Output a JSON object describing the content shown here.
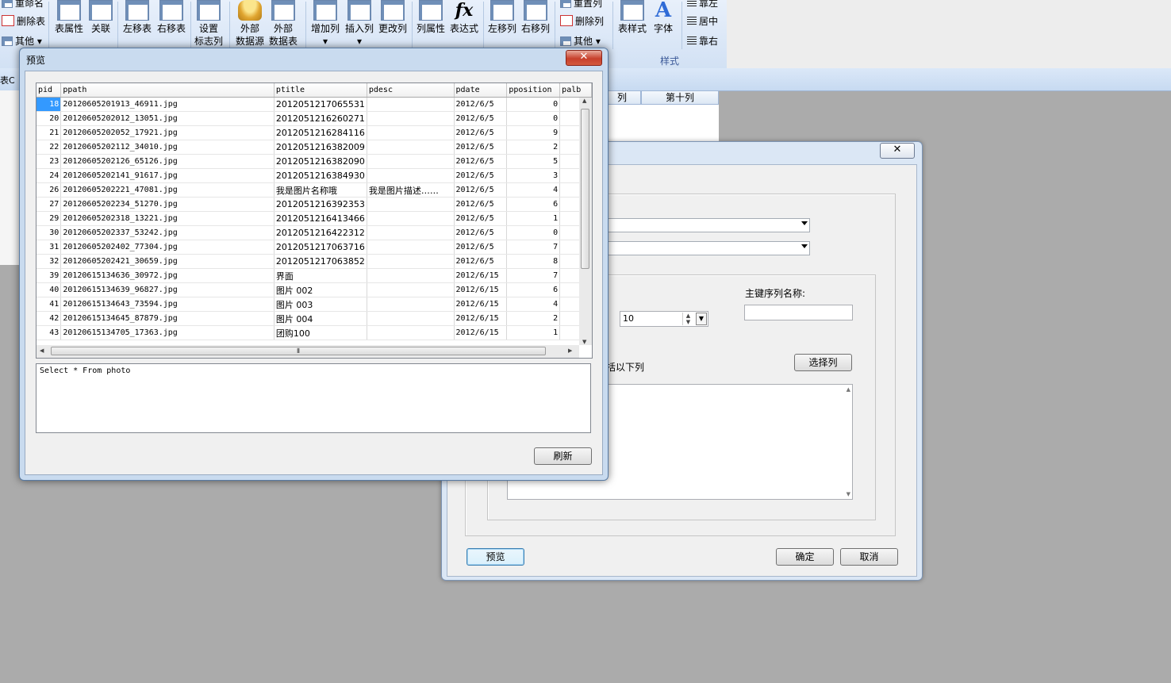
{
  "ribbon": {
    "small_left": [
      {
        "label": "重命名",
        "icon": "rename-icon"
      },
      {
        "label": "删除表",
        "icon": "delete-table-icon"
      },
      {
        "label": "其他",
        "icon": "other-icon"
      }
    ],
    "buttons": [
      {
        "label": "表属性",
        "icon": "table-properties-icon"
      },
      {
        "label": "关联",
        "icon": "relation-icon"
      },
      {
        "label": "左移表",
        "icon": "move-table-left-icon"
      },
      {
        "label": "右移表",
        "icon": "move-table-right-icon"
      },
      {
        "label": "设置\n标志列",
        "icon": "flag-column-icon"
      },
      {
        "label": "外部\n数据源",
        "icon": "external-datasource-icon"
      },
      {
        "label": "外部\n数据表",
        "icon": "external-table-icon"
      },
      {
        "label": "增加列",
        "icon": "add-column-icon"
      },
      {
        "label": "插入列",
        "icon": "insert-column-icon"
      },
      {
        "label": "更改列",
        "icon": "edit-column-icon"
      },
      {
        "label": "列属性",
        "icon": "column-properties-icon"
      },
      {
        "label": "表达式",
        "icon": "fx-icon"
      },
      {
        "label": "左移列",
        "icon": "move-column-left-icon"
      },
      {
        "label": "右移列",
        "icon": "move-column-right-icon"
      },
      {
        "label": "表样式",
        "icon": "table-style-icon"
      },
      {
        "label": "字体",
        "icon": "font-icon"
      }
    ],
    "small_mid": [
      {
        "label": "重置列",
        "icon": "reset-column-icon"
      },
      {
        "label": "删除列",
        "icon": "delete-column-icon"
      },
      {
        "label": "其他",
        "icon": "other-icon"
      }
    ],
    "small_align": [
      {
        "label": "靠左",
        "icon": "align-left-icon"
      },
      {
        "label": "居中",
        "icon": "align-center-icon"
      },
      {
        "label": "靠右",
        "icon": "align-right-icon"
      }
    ],
    "group_style": "样式"
  },
  "background": {
    "subbar_tab": "表C",
    "grid_headers": [
      "列",
      "第十列"
    ]
  },
  "bg_dialog": {
    "close_glyph": "✕",
    "pk_seq_label": "主键序列名称:",
    "spinner_value": "10",
    "include_cols_label": "括以下列",
    "select_cols_button": "选择列",
    "preview_button": "预览",
    "ok_button": "确定",
    "cancel_button": "取消"
  },
  "preview": {
    "title": "预览",
    "close_glyph": "✕",
    "columns": [
      "pid",
      "ppath",
      "ptitle",
      "pdesc",
      "pdate",
      "pposition",
      "palb"
    ],
    "rows": [
      [
        "18",
        "20120605201913_46911.jpg",
        "2012051217065531",
        "",
        "2012/6/5",
        "0"
      ],
      [
        "20",
        "20120605202012_13051.jpg",
        "2012051216260271",
        "",
        "2012/6/5",
        "0"
      ],
      [
        "21",
        "20120605202052_17921.jpg",
        "2012051216284116",
        "",
        "2012/6/5",
        "9"
      ],
      [
        "22",
        "20120605202112_34010.jpg",
        "2012051216382009",
        "",
        "2012/6/5",
        "2"
      ],
      [
        "23",
        "20120605202126_65126.jpg",
        "2012051216382090",
        "",
        "2012/6/5",
        "5"
      ],
      [
        "24",
        "20120605202141_91617.jpg",
        "2012051216384930",
        "",
        "2012/6/5",
        "3"
      ],
      [
        "26",
        "20120605202221_47081.jpg",
        "我是图片名称哦",
        "我是图片描述……",
        "2012/6/5",
        "4"
      ],
      [
        "27",
        "20120605202234_51270.jpg",
        "2012051216392353",
        "",
        "2012/6/5",
        "6"
      ],
      [
        "29",
        "20120605202318_13221.jpg",
        "2012051216413466",
        "",
        "2012/6/5",
        "1"
      ],
      [
        "30",
        "20120605202337_53242.jpg",
        "2012051216422312",
        "",
        "2012/6/5",
        "0"
      ],
      [
        "31",
        "20120605202402_77304.jpg",
        "2012051217063716",
        "",
        "2012/6/5",
        "7"
      ],
      [
        "32",
        "20120605202421_30659.jpg",
        "2012051217063852",
        "",
        "2012/6/5",
        "8"
      ],
      [
        "39",
        "20120615134636_30972.jpg",
        "界面",
        "",
        "2012/6/15",
        "7"
      ],
      [
        "40",
        "20120615134639_96827.jpg",
        "图片 002",
        "",
        "2012/6/15",
        "6"
      ],
      [
        "41",
        "20120615134643_73594.jpg",
        "图片 003",
        "",
        "2012/6/15",
        "4"
      ],
      [
        "42",
        "20120615134645_87879.jpg",
        "图片 004",
        "",
        "2012/6/15",
        "2"
      ],
      [
        "43",
        "20120615134705_17363.jpg",
        "团购100",
        "",
        "2012/6/15",
        "1"
      ]
    ],
    "sql": "Select * From photo",
    "refresh_button": "刷新"
  }
}
